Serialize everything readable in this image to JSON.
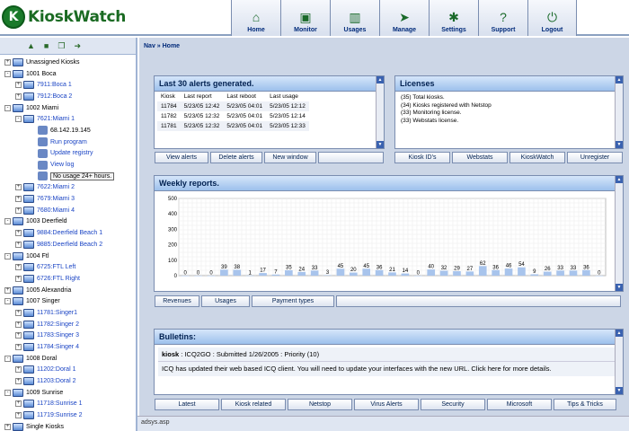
{
  "app": {
    "logo_text": "KioskWatch",
    "logo_mark": "K"
  },
  "nav": [
    {
      "label": "Home",
      "icon": "home-icon",
      "glyph": "⌂"
    },
    {
      "label": "Monitor",
      "icon": "monitor-icon",
      "glyph": "▣"
    },
    {
      "label": "Usages",
      "icon": "bar-chart-icon",
      "glyph": "▥"
    },
    {
      "label": "Manage",
      "icon": "cursor-icon",
      "glyph": "➤"
    },
    {
      "label": "Settings",
      "icon": "gear-icon",
      "glyph": "✱"
    },
    {
      "label": "Support",
      "icon": "question-icon",
      "glyph": "?"
    },
    {
      "label": "Logout",
      "icon": "power-icon",
      "glyph": "⏻"
    }
  ],
  "breadcrumb": "Nav » Home",
  "sidebar": {
    "tools": [
      "add-icon",
      "folder-icon",
      "copy-icon",
      "move-icon"
    ],
    "tree": [
      {
        "level": 1,
        "label": "Unassigned Kiosks",
        "pm": "+"
      },
      {
        "level": 1,
        "label": "1001 Boca",
        "pm": "-"
      },
      {
        "level": 2,
        "label": "7911:Boca 1",
        "pm": "+"
      },
      {
        "level": 2,
        "label": "7912:Boca 2",
        "pm": "+"
      },
      {
        "level": 1,
        "label": "1002 Miami",
        "pm": "-"
      },
      {
        "level": 2,
        "label": "7621:Miami 1",
        "pm": "-"
      },
      {
        "level": 3,
        "label": "68.142.19.145",
        "black": true
      },
      {
        "level": 3,
        "label": "Run program"
      },
      {
        "level": 3,
        "label": "Update registry"
      },
      {
        "level": 3,
        "label": "View log"
      },
      {
        "level": 3,
        "label": "No usage 24+ hours.",
        "highlight": true
      },
      {
        "level": 2,
        "label": "7622:Miami 2",
        "pm": "+"
      },
      {
        "level": 2,
        "label": "7679:Miami 3",
        "pm": "+"
      },
      {
        "level": 2,
        "label": "7680:Miami 4",
        "pm": "+"
      },
      {
        "level": 1,
        "label": "1003 Deerfield",
        "pm": "-"
      },
      {
        "level": 2,
        "label": "9884:Deerfield Beach 1",
        "pm": "+"
      },
      {
        "level": 2,
        "label": "9885:Deerfield Beach 2",
        "pm": "+"
      },
      {
        "level": 1,
        "label": "1004 Ftl",
        "pm": "-"
      },
      {
        "level": 2,
        "label": "6725:FTL Left",
        "pm": "+"
      },
      {
        "level": 2,
        "label": "6726:FTL Right",
        "pm": "+"
      },
      {
        "level": 1,
        "label": "1005 Alexandria",
        "pm": "+"
      },
      {
        "level": 1,
        "label": "1007 Singer",
        "pm": "-"
      },
      {
        "level": 2,
        "label": "11781:Singer1",
        "pm": "+"
      },
      {
        "level": 2,
        "label": "11782:Singer 2",
        "pm": "+"
      },
      {
        "level": 2,
        "label": "11783:Singer 3",
        "pm": "+"
      },
      {
        "level": 2,
        "label": "11784:Singer 4",
        "pm": "+"
      },
      {
        "level": 1,
        "label": "1008 Doral",
        "pm": "-"
      },
      {
        "level": 2,
        "label": "11202:Doral 1",
        "pm": "+"
      },
      {
        "level": 2,
        "label": "11203:Doral 2",
        "pm": "+"
      },
      {
        "level": 1,
        "label": "1009 Sunrise",
        "pm": "-"
      },
      {
        "level": 2,
        "label": "11718:Sunrise 1",
        "pm": "+"
      },
      {
        "level": 2,
        "label": "11719:Sunrise 2",
        "pm": "+"
      },
      {
        "level": 1,
        "label": "Single Kiosks",
        "pm": "+"
      }
    ]
  },
  "alerts": {
    "title": "Last 30 alerts generated.",
    "columns": [
      "Kiosk",
      "Last report",
      "Last reboot",
      "Last usage"
    ],
    "rows": [
      [
        "11784",
        "5/23/05 12:42",
        "5/23/05 04:01",
        "5/23/05 12:12"
      ],
      [
        "11782",
        "5/23/05 12:32",
        "5/23/05 04:01",
        "5/23/05 12:14"
      ],
      [
        "11781",
        "5/23/05 12:32",
        "5/23/05 04:01",
        "5/23/05 12:33"
      ]
    ],
    "buttons": [
      "View alerts",
      "Delete alerts",
      "New window",
      ""
    ]
  },
  "licenses": {
    "title": "Licenses",
    "lines": [
      "(35) Total kiosks.",
      "(34) Kiosks registered with Netstop",
      "(33) Monitoring license.",
      "(33) Webstats license."
    ],
    "buttons": [
      "Kiosk ID's",
      "Webstats",
      "KioskWatch",
      "Unregister"
    ]
  },
  "weekly": {
    "title": "Weekly reports.",
    "buttons": [
      "Revenues",
      "Usages",
      "Payment types",
      ""
    ]
  },
  "chart_data": {
    "type": "bar",
    "ylim": [
      0,
      500
    ],
    "yticks": [
      0,
      100,
      200,
      300,
      400,
      500
    ],
    "values": [
      0,
      0,
      0,
      39,
      38,
      1,
      17,
      7,
      35,
      24,
      33,
      3,
      45,
      20,
      45,
      36,
      21,
      14,
      0,
      40,
      32,
      29,
      27,
      62,
      36,
      46,
      54,
      9,
      26,
      33,
      33,
      36,
      0
    ]
  },
  "bulletins": {
    "title": "Bulletins:",
    "head_bold": "kiosk",
    "head_rest": " : ICQ2GO : Submitted  1/26/2005 : Priority (10)",
    "body": "ICQ has updated their web based ICQ client. You will need to update your interfaces with the new URL. Click here for more details.",
    "tabs": [
      "Latest",
      "Kiosk related",
      "Netstop",
      "Virus Alerts",
      "Security",
      "Microsoft",
      "Tips & Tricks"
    ]
  },
  "status_text": "adsys.asp"
}
